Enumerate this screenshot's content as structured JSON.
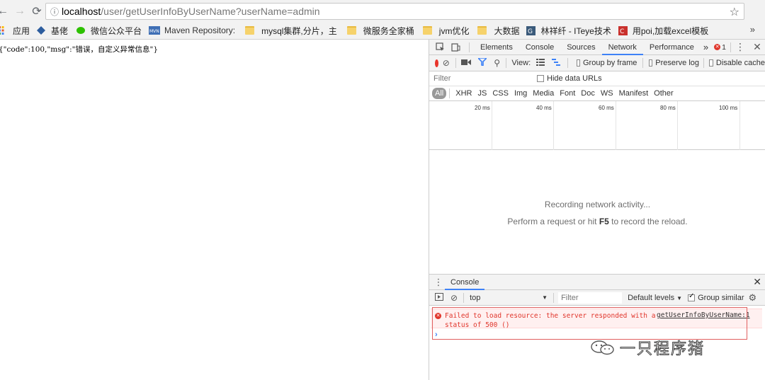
{
  "browser": {
    "url_host": "localhost",
    "url_path": "/user/getUserInfoByUserName?userName=admin"
  },
  "bookmarks": [
    {
      "label": "应用",
      "icon": "apps-grid-icon"
    },
    {
      "label": "基佬",
      "icon": "diamond-icon"
    },
    {
      "label": "微信公众平台",
      "icon": "wechat-icon"
    },
    {
      "label": "Maven Repository:",
      "icon": "mvn-icon"
    },
    {
      "label": "mysql集群,分片，主",
      "icon": "folder-icon"
    },
    {
      "label": "微服务全家桶",
      "icon": "folder-icon"
    },
    {
      "label": "jvm优化",
      "icon": "folder-icon"
    },
    {
      "label": "大数据",
      "icon": "folder-icon"
    },
    {
      "label": "林祥纤 - ITeye技术",
      "icon": "iteye-icon"
    },
    {
      "label": "用poi,加载excel模板",
      "icon": "csdn-icon"
    }
  ],
  "bookmarks_more": "»",
  "page": {
    "json_text": "{\"code\":100,\"msg\":\"错误，自定义异常信息\"}"
  },
  "devtools": {
    "tabs": [
      "Elements",
      "Console",
      "Sources",
      "Network",
      "Performance"
    ],
    "active_tab": "Network",
    "more_tabs": "»",
    "error_count": "1",
    "network_toolbar": {
      "view_label": "View:",
      "group_by_frame": "Group by frame",
      "preserve_log": "Preserve log",
      "disable_cache": "Disable cache"
    },
    "filter_placeholder": "Filter",
    "hide_data_urls": "Hide data URLs",
    "types": [
      "All",
      "XHR",
      "JS",
      "CSS",
      "Img",
      "Media",
      "Font",
      "Doc",
      "WS",
      "Manifest",
      "Other"
    ],
    "timeline_ticks": [
      "20 ms",
      "40 ms",
      "60 ms",
      "80 ms",
      "100 ms"
    ],
    "empty_title": "Recording network activity...",
    "empty_hint_before": "Perform a request or hit ",
    "empty_hint_key": "F5",
    "empty_hint_after": " to record the reload."
  },
  "console": {
    "title": "Console",
    "context": "top",
    "filter_placeholder": "Filter",
    "levels": "Default levels",
    "group_similar": "Group similar",
    "error_text": "Failed to load resource: the server responded with a\nstatus of 500 ()",
    "error_source": "getUserInfoByUserName:1",
    "prompt": "›"
  },
  "watermark": {
    "text": "一只程序猪"
  },
  "colors": {
    "record_red": "#e8342b",
    "tab_underline": "#3e82f7",
    "error_red": "#e0352b"
  }
}
